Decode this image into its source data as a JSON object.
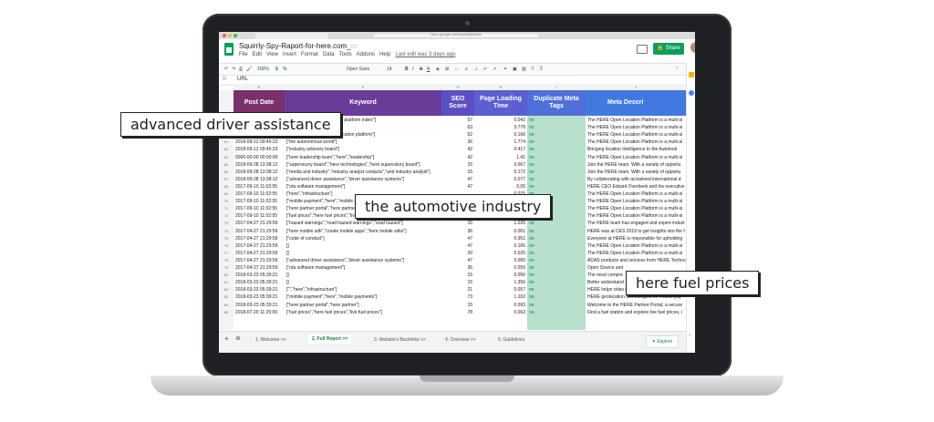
{
  "browser": {
    "url": "docs.google.com/spreadsheets"
  },
  "sheet": {
    "title": "Squirrly-Spy-Raport-for-here.com_",
    "menus": [
      "File",
      "Edit",
      "View",
      "Insert",
      "Format",
      "Data",
      "Tools",
      "Addons",
      "Help"
    ],
    "last_edit": "Last edit was 3 days ago",
    "share_label": "Share",
    "toolbar": {
      "zoom": "100%",
      "font": "Open Sans",
      "size": "14",
      "currency": "$",
      "percent": "%"
    },
    "formula_bar": {
      "fx": "fx",
      "value": "URL"
    },
    "column_letters": [
      "E",
      "F",
      "G",
      "H",
      "I",
      "J"
    ],
    "headers": [
      "Post Date",
      "Keyword",
      "SEO Score",
      "Page Loading Time",
      "Duplicate Meta Tags",
      "Meta Descri"
    ],
    "header_colors": [
      "#7b2f6b",
      "#6a3c9a",
      "#5b4fc2",
      "#5a5fd1",
      "#4f6fd9",
      "#4179e0"
    ],
    "rows": [
      {
        "n": "55",
        "date": "2018-08-13 18:56:20",
        "kw": "[\"location platform\",\"location platform index\"]",
        "seo": "57",
        "load": "0.042",
        "dup": "no",
        "meta": "The HERE Open Location Platform is a multi-si"
      },
      {
        "n": "57",
        "date": "2018-07-18 16:00:00",
        "kw": "[\"location map\",\"here map\"]",
        "seo": "63",
        "load": "3.778",
        "dup": "no",
        "meta": "The HERE Open Location Platform is a multi-si"
      },
      {
        "n": "59",
        "date": "2018-09-15 15:18:18",
        "kw": "[\"open location platform\",\"location platform\"]",
        "seo": "52",
        "load": "0.166",
        "dup": "no",
        "meta": "The HERE Open Location Platform is a multi-si"
      },
      {
        "n": "61",
        "date": "2018-09-12 09:45:23",
        "kw": "[\"the autonomous world\"]",
        "seo": "36",
        "load": "1.774",
        "dup": "no",
        "meta": "The HERE Open Location Platform is a multi-si"
      },
      {
        "n": "63",
        "date": "2018-09-12 09:45:23",
        "kw": "[\"industry advisory board\"]",
        "seo": "42",
        "load": "0.417",
        "dup": "no",
        "meta": "Bringing location intelligence to the Automoti"
      },
      {
        "n": "64",
        "date": "0000-00-00 00:00:00",
        "kw": "[\"here leadership team\",\"here\",\"leadership\"]",
        "seo": "42",
        "load": "1.41",
        "dup": "no",
        "meta": "The HERE Open Location Platform is a multi-si"
      },
      {
        "n": "65",
        "date": "2018-09-28 13:38:12",
        "kw": "[\"supervisory board\",\"here technologies\",\"here supervisory board\"]",
        "seo": "15",
        "load": "0.067",
        "dup": "no",
        "meta": "Join the HERE team. With a variety of opportu"
      },
      {
        "n": "66",
        "date": "2018-09-28 13:38:12",
        "kw": "[\"media and industry\",\"industry analyst contacts\",\"and industry analyst\"]",
        "seo": "15",
        "load": "0.172",
        "dup": "no",
        "meta": "Join the HERE team. With a variety of opportu"
      },
      {
        "n": "67",
        "date": "2018-09-28 13:38:12",
        "kw": "[\"advanced driver assistance\",\"driver assistance systems\"]",
        "seo": "47",
        "load": "0.077",
        "dup": "no",
        "meta": "By collaborating with acclaimed international d"
      },
      {
        "n": "68",
        "date": "2017-09-10 11:02:55",
        "kw": "[\"ota software management\"]",
        "seo": "47",
        "load": "0.05",
        "dup": "no",
        "meta": "HERE CEO Edzard Overbeek and his executive t"
      },
      {
        "n": "69",
        "date": "2017-09-10 11:02:55",
        "kw": "[\"here\",\"infrastructure\"]",
        "seo": "",
        "load": "0.075",
        "dup": "no",
        "meta": "The HERE Open Location Platform is a multi-si"
      },
      {
        "n": "70",
        "date": "2017-09-10 11:02:55",
        "kw": "[\"mobile payment\",\"here\",\"mobile payments\"]",
        "seo": "",
        "load": "0.059",
        "dup": "no",
        "meta": "The HERE Open Location Platform is a multi-si"
      },
      {
        "n": "71",
        "date": "2017-09-10 11:02:55",
        "kw": "[\"here partner portal\",\"here partner\"]",
        "seo": "",
        "load": "0.047",
        "dup": "no",
        "meta": "The HERE Open Location Platform is a multi-si"
      },
      {
        "n": "72",
        "date": "2017-09-10 11:02:55",
        "kw": "[\"fuel prices\",\"here fuel prices\",\"live fuel prices\"]",
        "seo": "",
        "load": "0.052",
        "dup": "no",
        "meta": "The HERE Open Location Platform is a multi-si"
      },
      {
        "n": "73",
        "date": "2017-04-27 21:29:59",
        "kw": "[\"hazard warnings\",\"road hazard warnings\",\"road hazard\"]",
        "seo": "15",
        "load": "1.026",
        "dup": "no",
        "meta": "The HERE team has engaged and expert indust"
      },
      {
        "n": "74",
        "date": "2017-04-27 21:29:59",
        "kw": "[\"here mobile sdk\",\"create mobile apps\",\"here mobile sdks\"]",
        "seo": "36",
        "load": "0.061",
        "dup": "no",
        "meta": "HERE was at CES 2019 to get insights into the f"
      },
      {
        "n": "75",
        "date": "2017-04-27 21:29:59",
        "kw": "[\"code of conduct\"]",
        "seo": "47",
        "load": "0.951",
        "dup": "no",
        "meta": "Everyone at HERE is responsible for upholding"
      },
      {
        "n": "76",
        "date": "2017-04-27 21:29:59",
        "kw": "[]",
        "seo": "47",
        "load": "0.166",
        "dup": "no",
        "meta": "The HERE Open Location Platform is a multi-si"
      },
      {
        "n": "77",
        "date": "2017-04-27 21:29:59",
        "kw": "[]",
        "seo": "20",
        "load": "0.025",
        "dup": "no",
        "meta": "The HERE Open Location Platform is a multi-si"
      },
      {
        "n": "78",
        "date": "2017-04-27 21:29:59",
        "kw": "[\"advanced driver assistance\",\"driver assistance systems\"]",
        "seo": "47",
        "load": "0.060",
        "dup": "no",
        "meta": "ADAS products and services from HERE Techno"
      },
      {
        "n": "79",
        "date": "2017-04-27 21:29:59",
        "kw": "[\"ota software management\"]",
        "seo": "36",
        "load": "0.059",
        "dup": "no",
        "meta": "Open Source and"
      },
      {
        "n": "80",
        "date": "2018-03-23 05:39:21",
        "kw": "[]",
        "seo": "15",
        "load": "0.056",
        "dup": "no",
        "meta": "The most compre"
      },
      {
        "n": "81",
        "date": "2018-03-23 05:39:21",
        "kw": "[]",
        "seo": "15",
        "load": "1.356",
        "dup": "no",
        "meta": "Better understand"
      },
      {
        "n": "82",
        "date": "2018-03-23 05:39:21",
        "kw": "[\"\",\"here\",\"infrastructure\"]",
        "seo": "21",
        "load": "0.057",
        "dup": "no",
        "meta": "HERE helps cities maintain their services, infra"
      },
      {
        "n": "83",
        "date": "2018-03-23 05:39:21",
        "kw": "[\"mobile payment\",\"here\",\"mobile payments\"]",
        "seo": "73",
        "load": "1.102",
        "dup": "no",
        "meta": "HERE geolocation technologies for mobile pay"
      },
      {
        "n": "84",
        "date": "2018-03-23 05:39:21",
        "kw": "[\"here partner portal\",\"here partner\"]",
        "seo": "15",
        "load": "0.093",
        "dup": "no",
        "meta": "Welcome to the HERE Partner Portal, a secure"
      },
      {
        "n": "85",
        "date": "2018-07-20 11:25:00",
        "kw": "[\"fuel prices\",\"here fuel prices\",\"live fuel prices\"]",
        "seo": "78",
        "load": "0.063",
        "dup": "no",
        "meta": "Find a fuel station and explore live fuel prices, i"
      }
    ],
    "tabs": [
      "1. Welcome >>",
      "2. Full Report >>",
      "3. Website's Backlinks >>",
      "4. Overview >>",
      "5. Guidelines"
    ],
    "explore_label": "Explore"
  },
  "callouts": {
    "c1": "advanced driver assistance",
    "c2": "the automotive industry",
    "c3": "here fuel prices"
  }
}
